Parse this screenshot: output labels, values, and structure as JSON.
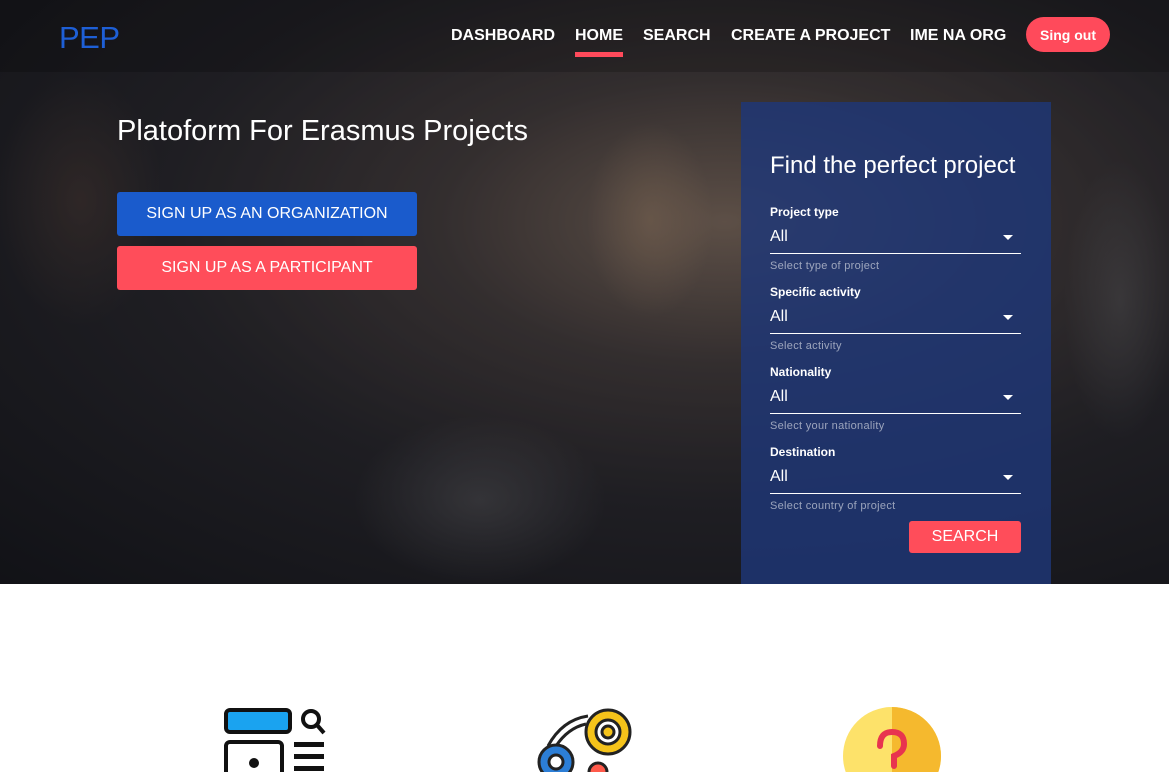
{
  "nav": {
    "logo": "PEP",
    "items": [
      "DASHBOARD",
      "HOME",
      "SEARCH",
      "CREATE A PROJECT",
      "IME NA ORG"
    ],
    "active": "HOME",
    "signout_label": "Sing out"
  },
  "hero": {
    "title": "Platoform For Erasmus Projects",
    "signup_org_label": "SIGN UP AS AN ORGANIZATION",
    "signup_participant_label": "SIGN UP AS A PARTICIPANT"
  },
  "search_panel": {
    "title": "Find the perfect project",
    "fields": [
      {
        "label": "Project type",
        "value": "All",
        "help": "Select type of project"
      },
      {
        "label": "Specific activity",
        "value": "All",
        "help": "Select activity"
      },
      {
        "label": "Nationality",
        "value": "All",
        "help": "Select your nationality"
      },
      {
        "label": "Destination",
        "value": "All",
        "help": "Select country of project"
      }
    ],
    "search_label": "SEARCH"
  },
  "features": {
    "icons": [
      "browser-search-icon",
      "gears-icon",
      "question-icon"
    ]
  },
  "colors": {
    "accent": "#ff4a5b",
    "brand_blue": "#1a5bcc",
    "panel": "#1e3778"
  }
}
